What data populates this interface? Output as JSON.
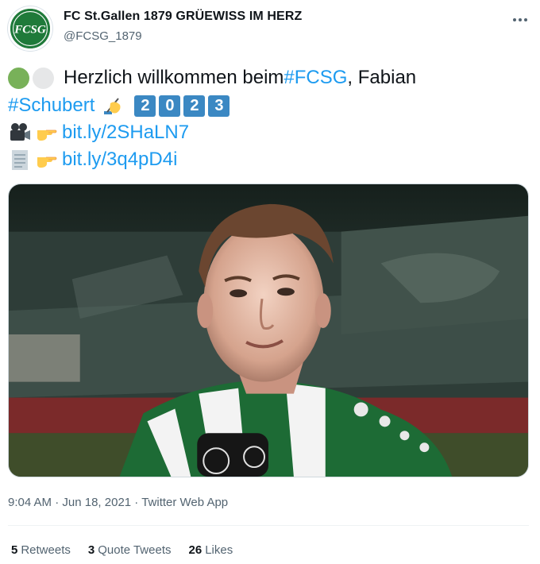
{
  "author": {
    "name": "FC St.Gallen 1879 GRÜEWISS IM HERZ",
    "handle": "@FCSG_1879",
    "avatar_text": "FCSG"
  },
  "tweet": {
    "line1_text": "Herzlich willkommen beim ",
    "line1_hashtag": "#FCSG",
    "line1_suffix": ", Fabian",
    "line2_hashtag": "#Schubert",
    "year_digits": [
      "2",
      "0",
      "2",
      "3"
    ],
    "link1": "bit.ly/2SHaLN7",
    "link2": "bit.ly/3q4pD4i"
  },
  "meta": {
    "time": "9:04 AM",
    "sep1": " · ",
    "date": "Jun 18, 2021",
    "sep2": " · ",
    "source": "Twitter Web App"
  },
  "stats": {
    "retweets_count": "5",
    "retweets_label": "Retweets",
    "quotes_count": "3",
    "quotes_label": "Quote Tweets",
    "likes_count": "26",
    "likes_label": "Likes"
  },
  "colors": {
    "link": "#1d9bf0",
    "keycap": "#3b88c3",
    "club_green": "#1f7a3a"
  },
  "icons": [
    "more-options-icon",
    "green-circle-icon",
    "white-circle-icon",
    "writing-hand-icon",
    "movie-camera-icon",
    "pointing-hand-icon",
    "document-icon"
  ]
}
